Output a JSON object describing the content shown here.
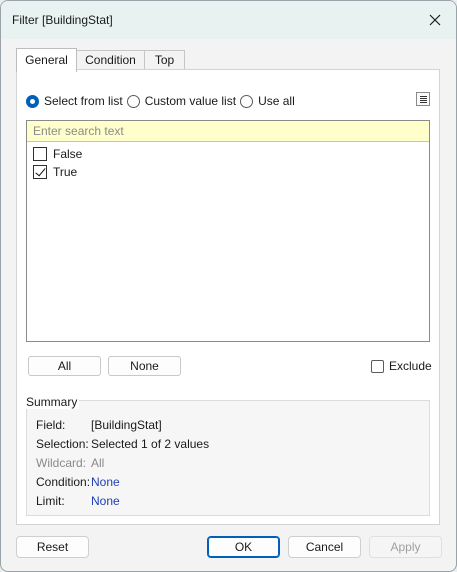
{
  "window": {
    "title": "Filter [BuildingStat]"
  },
  "tabs": [
    {
      "label": "General",
      "active": true
    },
    {
      "label": "Condition",
      "active": false
    },
    {
      "label": "Top",
      "active": false
    }
  ],
  "mode": {
    "options": [
      {
        "label": "Select from list",
        "selected": true
      },
      {
        "label": "Custom value list",
        "selected": false
      },
      {
        "label": "Use all",
        "selected": false
      }
    ]
  },
  "list": {
    "search_placeholder": "Enter search text",
    "items": [
      {
        "label": "False",
        "checked": false
      },
      {
        "label": "True",
        "checked": true
      }
    ]
  },
  "buttons": {
    "all_label": "All",
    "none_label": "None",
    "exclude_label": "Exclude"
  },
  "summary": {
    "title": "Summary",
    "rows": [
      {
        "label": "Field:",
        "value": "[BuildingStat]"
      },
      {
        "label": "Selection:",
        "value": "Selected 1 of 2 values"
      },
      {
        "label": "Wildcard:",
        "value": "All"
      },
      {
        "label": "Condition:",
        "value": "None"
      },
      {
        "label": "Limit:",
        "value": "None"
      }
    ]
  },
  "footer": {
    "reset_label": "Reset",
    "ok_label": "OK",
    "cancel_label": "Cancel",
    "apply_label": "Apply"
  },
  "colors": {
    "accent": "#005fb8",
    "search_bg": "#ffffcc",
    "link": "#1f3fb5"
  }
}
